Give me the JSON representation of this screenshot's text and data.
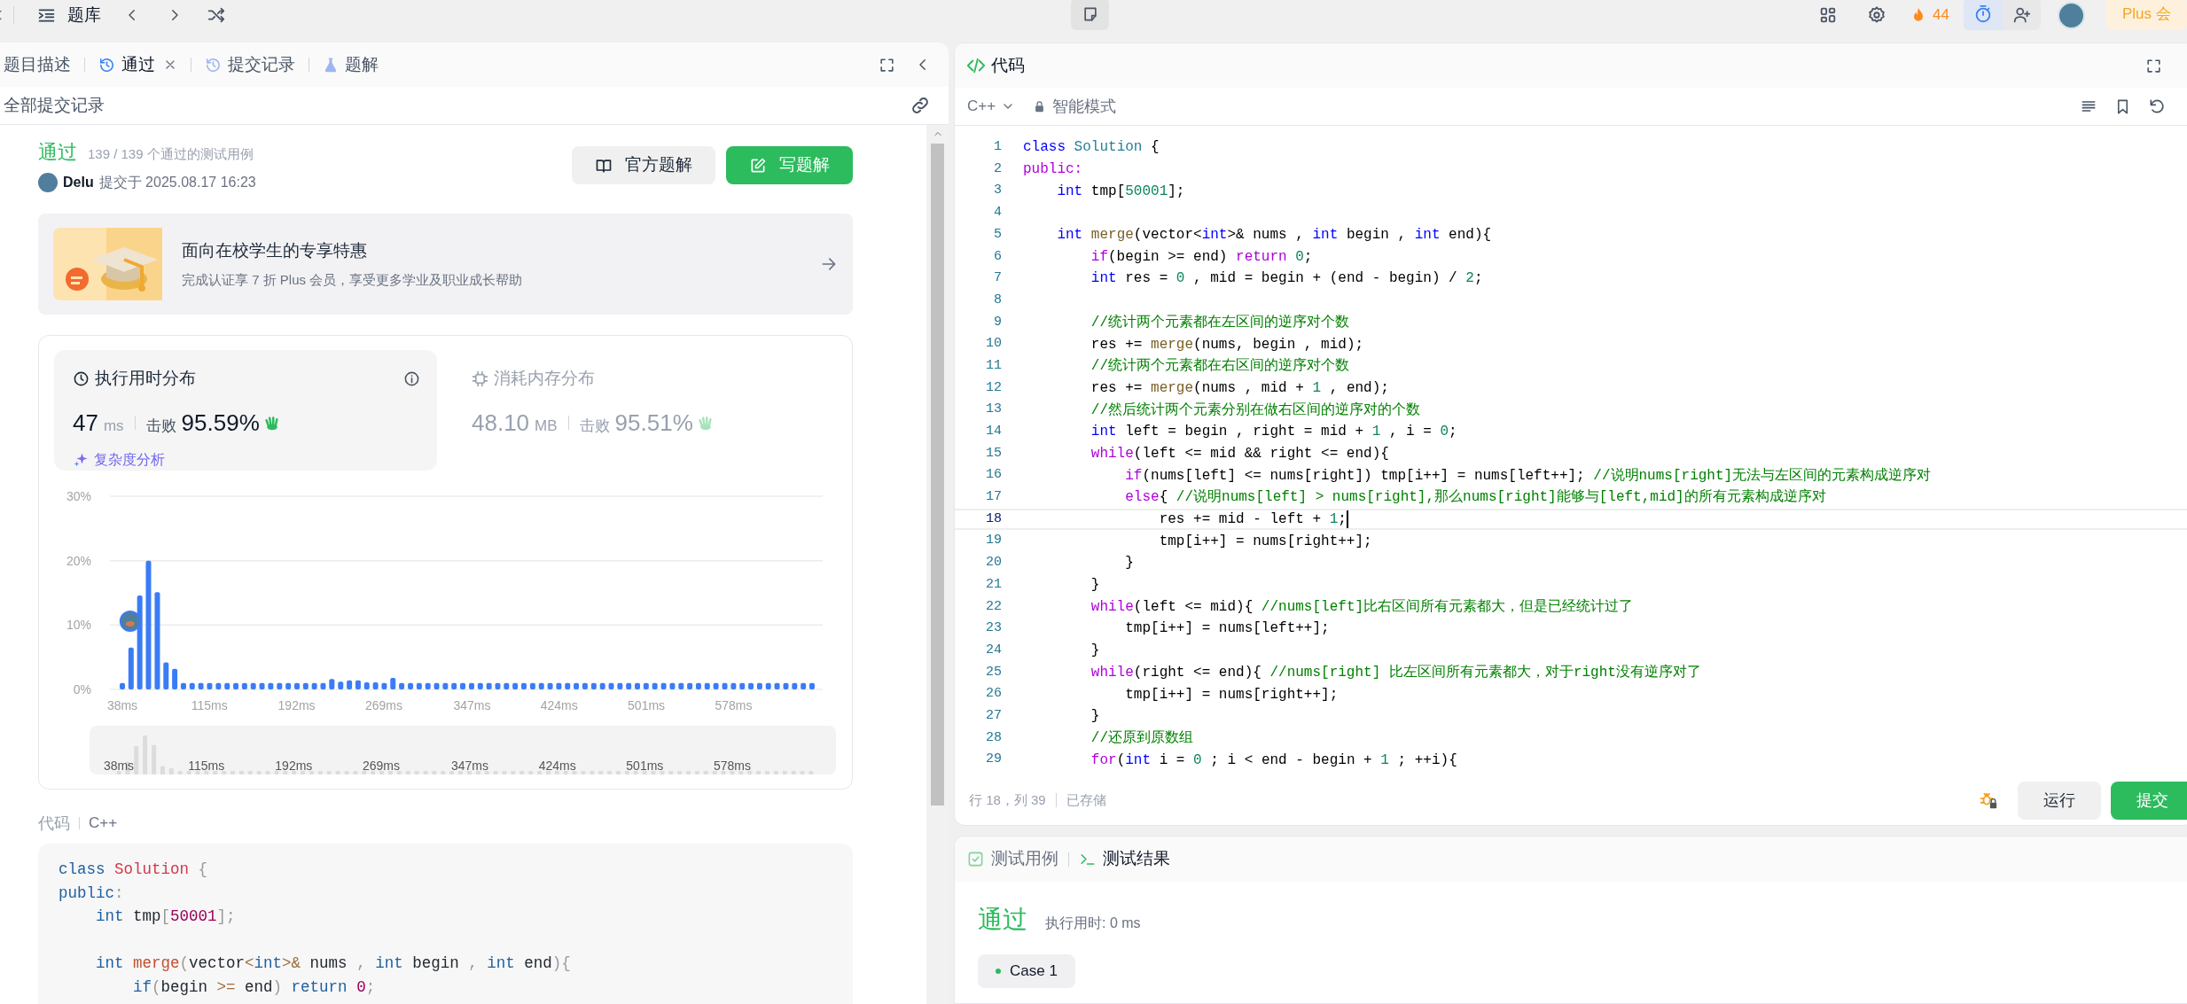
{
  "top_bar": {
    "title": "题库",
    "streak": "44",
    "plus": "Plus 会"
  },
  "left_panel": {
    "tabs": [
      {
        "label": "题目描述",
        "kind": "description",
        "selected": false,
        "closable": false
      },
      {
        "label": "通过",
        "kind": "result",
        "selected": true,
        "closable": true
      },
      {
        "label": "提交记录",
        "kind": "history",
        "selected": false,
        "closable": false
      },
      {
        "label": "题解",
        "kind": "solution",
        "selected": false,
        "closable": false
      }
    ],
    "subheader": "全部提交记录",
    "submission": {
      "status": "通过",
      "cases": "139 / 139 个通过的测试用例",
      "user": "Delu",
      "submitted": "提交于 2025.08.17 16:23",
      "buttons": [
        {
          "label": "官方题解",
          "kind": "book",
          "primary": false
        },
        {
          "label": "写题解",
          "kind": "edit",
          "primary": true
        }
      ]
    },
    "promo": {
      "title": "面向在校学生的专享特惠",
      "subtitle": "完成认证享 7 折 Plus 会员，享受更多学业及职业成长帮助"
    },
    "stats": [
      {
        "kind": "runtime",
        "title": "执行用时分布",
        "selected": true,
        "value": "47",
        "unit": "ms",
        "beat_label": "击败",
        "beat": "95.59%",
        "link": "复杂度分析"
      },
      {
        "kind": "memory",
        "title": "消耗内存分布",
        "selected": false,
        "value": "48.10",
        "unit": "MB",
        "beat_label": "击败",
        "beat": "95.51%"
      }
    ],
    "chart_data": {
      "type": "bar",
      "x": [
        38,
        45.7,
        53.4,
        61.1,
        68.9,
        76.6,
        84.3,
        92.0,
        99.7,
        107.4,
        115.1,
        122.9,
        130.6,
        138.3,
        146.0,
        153.7,
        161.4,
        169.1,
        176.9,
        184.6,
        192.3,
        200.0,
        207.7,
        215.4,
        223.1,
        230.9,
        238.6,
        246.3,
        254.0,
        261.7,
        269.4,
        277.1,
        284.8,
        292.6,
        300.3,
        308.0,
        315.7,
        323.4,
        331.1,
        338.8,
        346.6,
        354.3,
        362.0,
        369.7,
        377.4,
        385.1,
        392.8,
        400.6,
        408.3,
        416.0,
        423.7,
        431.4,
        439.1,
        446.8,
        454.6,
        462.3,
        470.0,
        477.7,
        485.4,
        493.1,
        500.8,
        508.5,
        516.3,
        524.0,
        531.7,
        539.4,
        547.1,
        554.8,
        562.5,
        570.3,
        578.0,
        585.7,
        593.4,
        601.1,
        608.8,
        616.5,
        624.3,
        632.0,
        639.7,
        647.4
      ],
      "values": [
        1,
        6.5,
        14.6,
        20,
        15.1,
        4.2,
        3.2,
        1,
        1,
        1,
        1,
        1,
        1,
        1,
        1,
        1,
        1,
        1,
        1,
        1,
        1,
        1,
        1,
        1,
        1.6,
        1.2,
        1.4,
        1.4,
        1.1,
        1.1,
        1.0,
        1.8,
        1,
        1,
        1,
        1,
        1,
        1,
        1,
        1,
        1,
        1,
        1,
        1,
        1,
        1,
        1,
        1,
        1,
        1,
        1,
        1,
        1,
        1,
        1,
        1,
        1,
        1,
        1,
        1,
        1,
        1,
        1,
        1,
        1,
        1,
        1,
        1,
        1,
        1,
        1,
        1,
        1,
        1,
        1,
        1,
        1,
        1,
        1,
        1
      ],
      "xlim": [
        38,
        647.4
      ],
      "ylim": [
        0,
        30
      ],
      "xticks": [
        {
          "value": 38,
          "label": "38ms"
        },
        {
          "value": 115,
          "label": "115ms"
        },
        {
          "value": 192,
          "label": "192ms"
        },
        {
          "value": 269,
          "label": "269ms"
        },
        {
          "value": 347,
          "label": "347ms"
        },
        {
          "value": 424,
          "label": "424ms"
        },
        {
          "value": 501,
          "label": "501ms"
        },
        {
          "value": 578,
          "label": "578ms"
        }
      ],
      "yticks": [
        {
          "value": 0,
          "label": "0%"
        },
        {
          "value": 10,
          "label": "10%"
        },
        {
          "value": 20,
          "label": "20%"
        },
        {
          "value": 30,
          "label": "30%"
        }
      ]
    },
    "overview_labels": [
      "38ms",
      "115ms",
      "192ms",
      "269ms",
      "347ms",
      "424ms",
      "501ms",
      "578ms"
    ],
    "code_label": "代码",
    "code_lang": "C++",
    "code": [
      {
        "kind": "line",
        "tokens": [
          {
            "kind": "kw",
            "text": "class"
          },
          {
            "kind": "cls",
            "text": " Solution"
          },
          {
            "kind": "p",
            "text": " {"
          }
        ]
      },
      {
        "kind": "line",
        "tokens": [
          {
            "kind": "kw",
            "text": "public"
          },
          {
            "kind": "p",
            "text": ":"
          }
        ]
      },
      {
        "kind": "line",
        "tokens": [
          {
            "kind": "kw",
            "text": "    int"
          },
          {
            "kind": "tx",
            "text": " tmp"
          },
          {
            "kind": "p",
            "text": "["
          },
          {
            "kind": "num",
            "text": "50001"
          },
          {
            "kind": "p",
            "text": "];"
          }
        ]
      },
      {
        "kind": "blank"
      },
      {
        "kind": "line",
        "tokens": [
          {
            "kind": "kw",
            "text": "    int"
          },
          {
            "kind": "fn",
            "text": " merge"
          },
          {
            "kind": "p",
            "text": "("
          },
          {
            "kind": "tx",
            "text": "vector"
          },
          {
            "kind": "op",
            "text": "<"
          },
          {
            "kind": "kw",
            "text": "int"
          },
          {
            "kind": "op",
            "text": ">&"
          },
          {
            "kind": "tx",
            "text": " nums "
          },
          {
            "kind": "p",
            "text": ","
          },
          {
            "kind": "kw",
            "text": " int"
          },
          {
            "kind": "tx",
            "text": " begin "
          },
          {
            "kind": "p",
            "text": ","
          },
          {
            "kind": "kw",
            "text": " int"
          },
          {
            "kind": "tx",
            "text": " end"
          },
          {
            "kind": "p",
            "text": "){"
          }
        ]
      },
      {
        "kind": "line",
        "tokens": [
          {
            "kind": "kw",
            "text": "        if"
          },
          {
            "kind": "p",
            "text": "("
          },
          {
            "kind": "tx",
            "text": "begin "
          },
          {
            "kind": "op",
            "text": ">="
          },
          {
            "kind": "tx",
            "text": " end"
          },
          {
            "kind": "p",
            "text": ")"
          },
          {
            "kind": "kw",
            "text": " return"
          },
          {
            "kind": "num",
            "text": " 0"
          },
          {
            "kind": "p",
            "text": ";"
          }
        ]
      }
    ]
  },
  "editor": {
    "title": "代码",
    "language": "C++",
    "mode": "智能模式",
    "lines": [
      {
        "n": "1",
        "current": false,
        "tokens": [
          {
            "kind": "kw",
            "text": "class"
          },
          {
            "kind": "cls",
            "text": " Solution"
          },
          {
            "kind": "tx",
            "text": " {"
          }
        ]
      },
      {
        "n": "2",
        "current": false,
        "tokens": [
          {
            "kind": "ctrl",
            "text": "public:"
          }
        ]
      },
      {
        "n": "3",
        "current": false,
        "tokens": [
          {
            "kind": "kw",
            "text": "    int"
          },
          {
            "kind": "tx",
            "text": " tmp["
          },
          {
            "kind": "num",
            "text": "50001"
          },
          {
            "kind": "tx",
            "text": "];"
          }
        ]
      },
      {
        "n": "4",
        "current": false
      },
      {
        "n": "5",
        "current": false,
        "tokens": [
          {
            "kind": "kw",
            "text": "    int"
          },
          {
            "kind": "fn",
            "text": " merge"
          },
          {
            "kind": "tx",
            "text": "(vector<"
          },
          {
            "kind": "kw",
            "text": "int"
          },
          {
            "kind": "tx",
            "text": ">& nums , "
          },
          {
            "kind": "kw",
            "text": "int"
          },
          {
            "kind": "tx",
            "text": " begin , "
          },
          {
            "kind": "kw",
            "text": "int"
          },
          {
            "kind": "tx",
            "text": " end){"
          }
        ]
      },
      {
        "n": "6",
        "current": false,
        "tokens": [
          {
            "kind": "ctrl",
            "text": "        if"
          },
          {
            "kind": "tx",
            "text": "(begin >= end) "
          },
          {
            "kind": "ctrl",
            "text": "return"
          },
          {
            "kind": "num",
            "text": " 0"
          },
          {
            "kind": "tx",
            "text": ";"
          }
        ]
      },
      {
        "n": "7",
        "current": false,
        "tokens": [
          {
            "kind": "kw",
            "text": "        int"
          },
          {
            "kind": "tx",
            "text": " res = "
          },
          {
            "kind": "num",
            "text": "0"
          },
          {
            "kind": "tx",
            "text": " , mid = begin + (end - begin) / "
          },
          {
            "kind": "num",
            "text": "2"
          },
          {
            "kind": "tx",
            "text": ";"
          }
        ]
      },
      {
        "n": "8",
        "current": false
      },
      {
        "n": "9",
        "current": false,
        "tokens": [
          {
            "kind": "cm",
            "text": "        //统计两个元素都在左区间的逆序对个数"
          }
        ]
      },
      {
        "n": "10",
        "current": false,
        "tokens": [
          {
            "kind": "tx",
            "text": "        res += "
          },
          {
            "kind": "fn",
            "text": "merge"
          },
          {
            "kind": "tx",
            "text": "(nums, begin , mid);"
          }
        ]
      },
      {
        "n": "11",
        "current": false,
        "tokens": [
          {
            "kind": "cm",
            "text": "        //统计两个元素都在右区间的逆序对个数"
          }
        ]
      },
      {
        "n": "12",
        "current": false,
        "tokens": [
          {
            "kind": "tx",
            "text": "        res += "
          },
          {
            "kind": "fn",
            "text": "merge"
          },
          {
            "kind": "tx",
            "text": "(nums , mid + "
          },
          {
            "kind": "num",
            "text": "1"
          },
          {
            "kind": "tx",
            "text": " , end);"
          }
        ]
      },
      {
        "n": "13",
        "current": false,
        "tokens": [
          {
            "kind": "cm",
            "text": "        //然后统计两个元素分别在做右区间的逆序对的个数"
          }
        ]
      },
      {
        "n": "14",
        "current": false,
        "tokens": [
          {
            "kind": "kw",
            "text": "        int"
          },
          {
            "kind": "tx",
            "text": " left = begin , right = mid + "
          },
          {
            "kind": "num",
            "text": "1"
          },
          {
            "kind": "tx",
            "text": " , i = "
          },
          {
            "kind": "num",
            "text": "0"
          },
          {
            "kind": "tx",
            "text": ";"
          }
        ]
      },
      {
        "n": "15",
        "current": false,
        "tokens": [
          {
            "kind": "ctrl",
            "text": "        while"
          },
          {
            "kind": "tx",
            "text": "(left <= mid && right <= end){"
          }
        ]
      },
      {
        "n": "16",
        "current": false,
        "tokens": [
          {
            "kind": "ctrl",
            "text": "            if"
          },
          {
            "kind": "tx",
            "text": "(nums[left] <= nums[right]) tmp[i++] = nums[left++]; "
          },
          {
            "kind": "cm",
            "text": "//说明nums[right]无法与左区间的元素构成逆序对"
          }
        ]
      },
      {
        "n": "17",
        "current": false,
        "tokens": [
          {
            "kind": "ctrl",
            "text": "            else"
          },
          {
            "kind": "tx",
            "text": "{ "
          },
          {
            "kind": "cm",
            "text": "//说明nums[left] > nums[right],那么nums[right]能够与[left,mid]的所有元素构成逆序对"
          }
        ]
      },
      {
        "n": "18",
        "current": true,
        "tokens": [
          {
            "kind": "tx",
            "text": "                res += mid - left + "
          },
          {
            "kind": "num",
            "text": "1"
          },
          {
            "kind": "tx",
            "text": ";"
          }
        ]
      },
      {
        "n": "19",
        "current": false,
        "tokens": [
          {
            "kind": "tx",
            "text": "                tmp[i++] = nums[right++];"
          }
        ]
      },
      {
        "n": "20",
        "current": false,
        "tokens": [
          {
            "kind": "tx",
            "text": "            }"
          }
        ]
      },
      {
        "n": "21",
        "current": false,
        "tokens": [
          {
            "kind": "tx",
            "text": "        }"
          }
        ]
      },
      {
        "n": "22",
        "current": false,
        "tokens": [
          {
            "kind": "ctrl",
            "text": "        while"
          },
          {
            "kind": "tx",
            "text": "(left <= mid){ "
          },
          {
            "kind": "cm",
            "text": "//nums[left]比右区间所有元素都大，但是已经统计过了"
          }
        ]
      },
      {
        "n": "23",
        "current": false,
        "tokens": [
          {
            "kind": "tx",
            "text": "            tmp[i++] = nums[left++];"
          }
        ]
      },
      {
        "n": "24",
        "current": false,
        "tokens": [
          {
            "kind": "tx",
            "text": "        }"
          }
        ]
      },
      {
        "n": "25",
        "current": false,
        "tokens": [
          {
            "kind": "ctrl",
            "text": "        while"
          },
          {
            "kind": "tx",
            "text": "(right <= end){ "
          },
          {
            "kind": "cm",
            "text": "//nums[right] 比左区间所有元素都大，对于right没有逆序对了"
          }
        ]
      },
      {
        "n": "26",
        "current": false,
        "tokens": [
          {
            "kind": "tx",
            "text": "            tmp[i++] = nums[right++];"
          }
        ]
      },
      {
        "n": "27",
        "current": false,
        "tokens": [
          {
            "kind": "tx",
            "text": "        }"
          }
        ]
      },
      {
        "n": "28",
        "current": false,
        "tokens": [
          {
            "kind": "cm",
            "text": "        //还原到原数组"
          }
        ]
      },
      {
        "n": "29",
        "current": false,
        "tokens": [
          {
            "kind": "ctrl",
            "text": "        for"
          },
          {
            "kind": "tx",
            "text": "("
          },
          {
            "kind": "kw",
            "text": "int"
          },
          {
            "kind": "tx",
            "text": " i = "
          },
          {
            "kind": "num",
            "text": "0"
          },
          {
            "kind": "tx",
            "text": " ; i < end - begin + "
          },
          {
            "kind": "num",
            "text": "1"
          },
          {
            "kind": "tx",
            "text": " ; ++i){"
          }
        ]
      }
    ],
    "status": {
      "position": "行 18，列 39",
      "saved": "已存储"
    },
    "buttons": [
      {
        "label": "运行",
        "primary": false
      },
      {
        "label": "提交",
        "primary": true
      }
    ]
  },
  "console": {
    "tabs": [
      {
        "label": "测试用例",
        "kind": "testcase",
        "selected": false
      },
      {
        "label": "测试结果",
        "kind": "result",
        "selected": true
      }
    ],
    "status": "通过",
    "runtime": "执行用时: 0 ms",
    "cases": [
      {
        "label": "Case 1",
        "passed": true
      }
    ]
  }
}
